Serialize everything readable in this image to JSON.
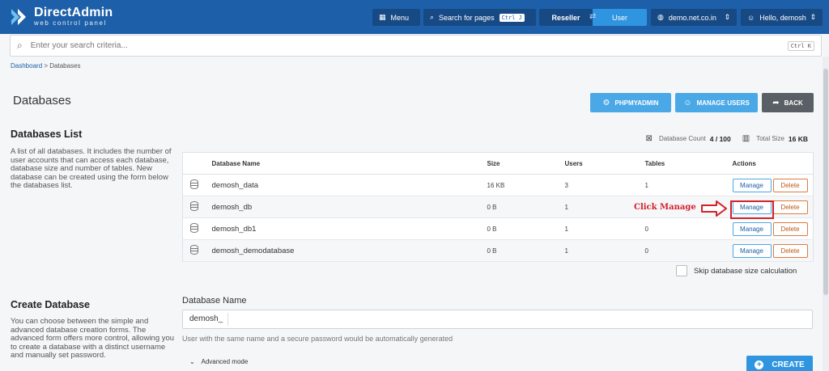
{
  "header": {
    "logo_name": "DirectAdmin",
    "logo_sub": "web control panel",
    "menu_label": "Menu",
    "search_pages_label": "Search for pages",
    "search_shortcut": "Ctrl J",
    "level_reseller": "Reseller",
    "level_user": "User",
    "domain": "demo.net.co.in",
    "greeting": "Hello, demosh"
  },
  "search": {
    "placeholder": "Enter your search criteria...",
    "shortcut": "Ctrl K"
  },
  "breadcrumb": {
    "home": "Dashboard",
    "sep": ">",
    "current": "Databases"
  },
  "page": {
    "title": "Databases",
    "phpmyadmin": "PHPMYADMIN",
    "manage_users": "MANAGE USERS",
    "back": "BACK"
  },
  "list": {
    "title": "Databases List",
    "description": "A list of all databases. It includes the number of user accounts that can access each database, database size and number of tables. New database can be created using the form below the databases list.",
    "count_label": "Database Count",
    "count_value": "4 / 100",
    "size_label": "Total Size",
    "size_value": "16 KB",
    "columns": [
      "Database Name",
      "Size",
      "Users",
      "Tables",
      "Actions"
    ],
    "rows": [
      {
        "name": "demosh_data",
        "size": "16 KB",
        "users": "3",
        "tables": "1"
      },
      {
        "name": "demosh_db",
        "size": "0 B",
        "users": "1",
        "tables": ""
      },
      {
        "name": "demosh_db1",
        "size": "0 B",
        "users": "1",
        "tables": "0"
      },
      {
        "name": "demosh_demodatabase",
        "size": "0 B",
        "users": "1",
        "tables": "0"
      }
    ],
    "manage_label": "Manage",
    "delete_label": "Delete",
    "skip_label": "Skip database size calculation"
  },
  "annotation": {
    "text": "Click Manage",
    "color": "#d3212a"
  },
  "create": {
    "title": "Create Database",
    "description": "You can choose between the simple and advanced database creation forms. The advanced form offers more control, allowing you to create a database with a distinct username and manually set password.",
    "field_label": "Database Name",
    "prefix": "demosh_",
    "hint": "User with the same name and a secure password would be automatically generated",
    "advanced": "Advanced mode",
    "create_label": "CREATE"
  },
  "colors": {
    "header": "#1d5fa8",
    "accent": "#4aa8e6",
    "primary": "#2f95e0",
    "danger": "#e07a3a"
  }
}
